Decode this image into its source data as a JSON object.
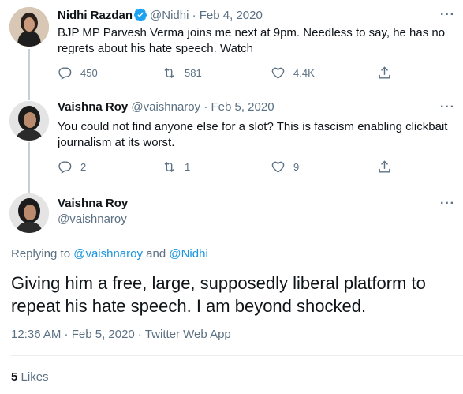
{
  "tweets": [
    {
      "name": "Nidhi Razdan",
      "verified": true,
      "handle": "@Nidhi",
      "date": "· Feb 4, 2020",
      "text": "BJP MP Parvesh Verma joins me next at 9pm. Needless to say, he has no regrets about his hate speech. Watch",
      "replies": "450",
      "retweets": "581",
      "likes": "4.4K",
      "more_label": "···"
    },
    {
      "name": "Vaishna Roy",
      "verified": false,
      "handle": "@vaishnaroy",
      "date": "· Feb 5, 2020",
      "text": "You could not find anyone else for a slot? This is fascism enabling clickbait journalism at its worst.",
      "replies": "2",
      "retweets": "1",
      "likes": "9",
      "more_label": "···"
    }
  ],
  "main": {
    "name": "Vaishna Roy",
    "handle": "@vaishnaroy",
    "more_label": "···",
    "replying_prefix": "Replying to",
    "replying_to_1": "@vaishnaroy",
    "replying_and": "and",
    "replying_to_2": "@Nidhi",
    "text": "Giving him a free, large, supposedly liberal platform to repeat his hate speech. I am beyond shocked.",
    "timestamp": "12:36 AM · Feb 5, 2020 · Twitter Web App",
    "likes_count": "5",
    "likes_label": "Likes"
  },
  "icons": {
    "reply": "reply-icon",
    "retweet": "retweet-icon",
    "like": "heart-icon",
    "share": "share-icon",
    "verified": "verified-badge-icon",
    "more": "more-icon"
  },
  "colors": {
    "link": "#1b95e0",
    "muted": "#5b7083",
    "verified": "#1da1f2",
    "thread_line": "#c4cfd6"
  }
}
